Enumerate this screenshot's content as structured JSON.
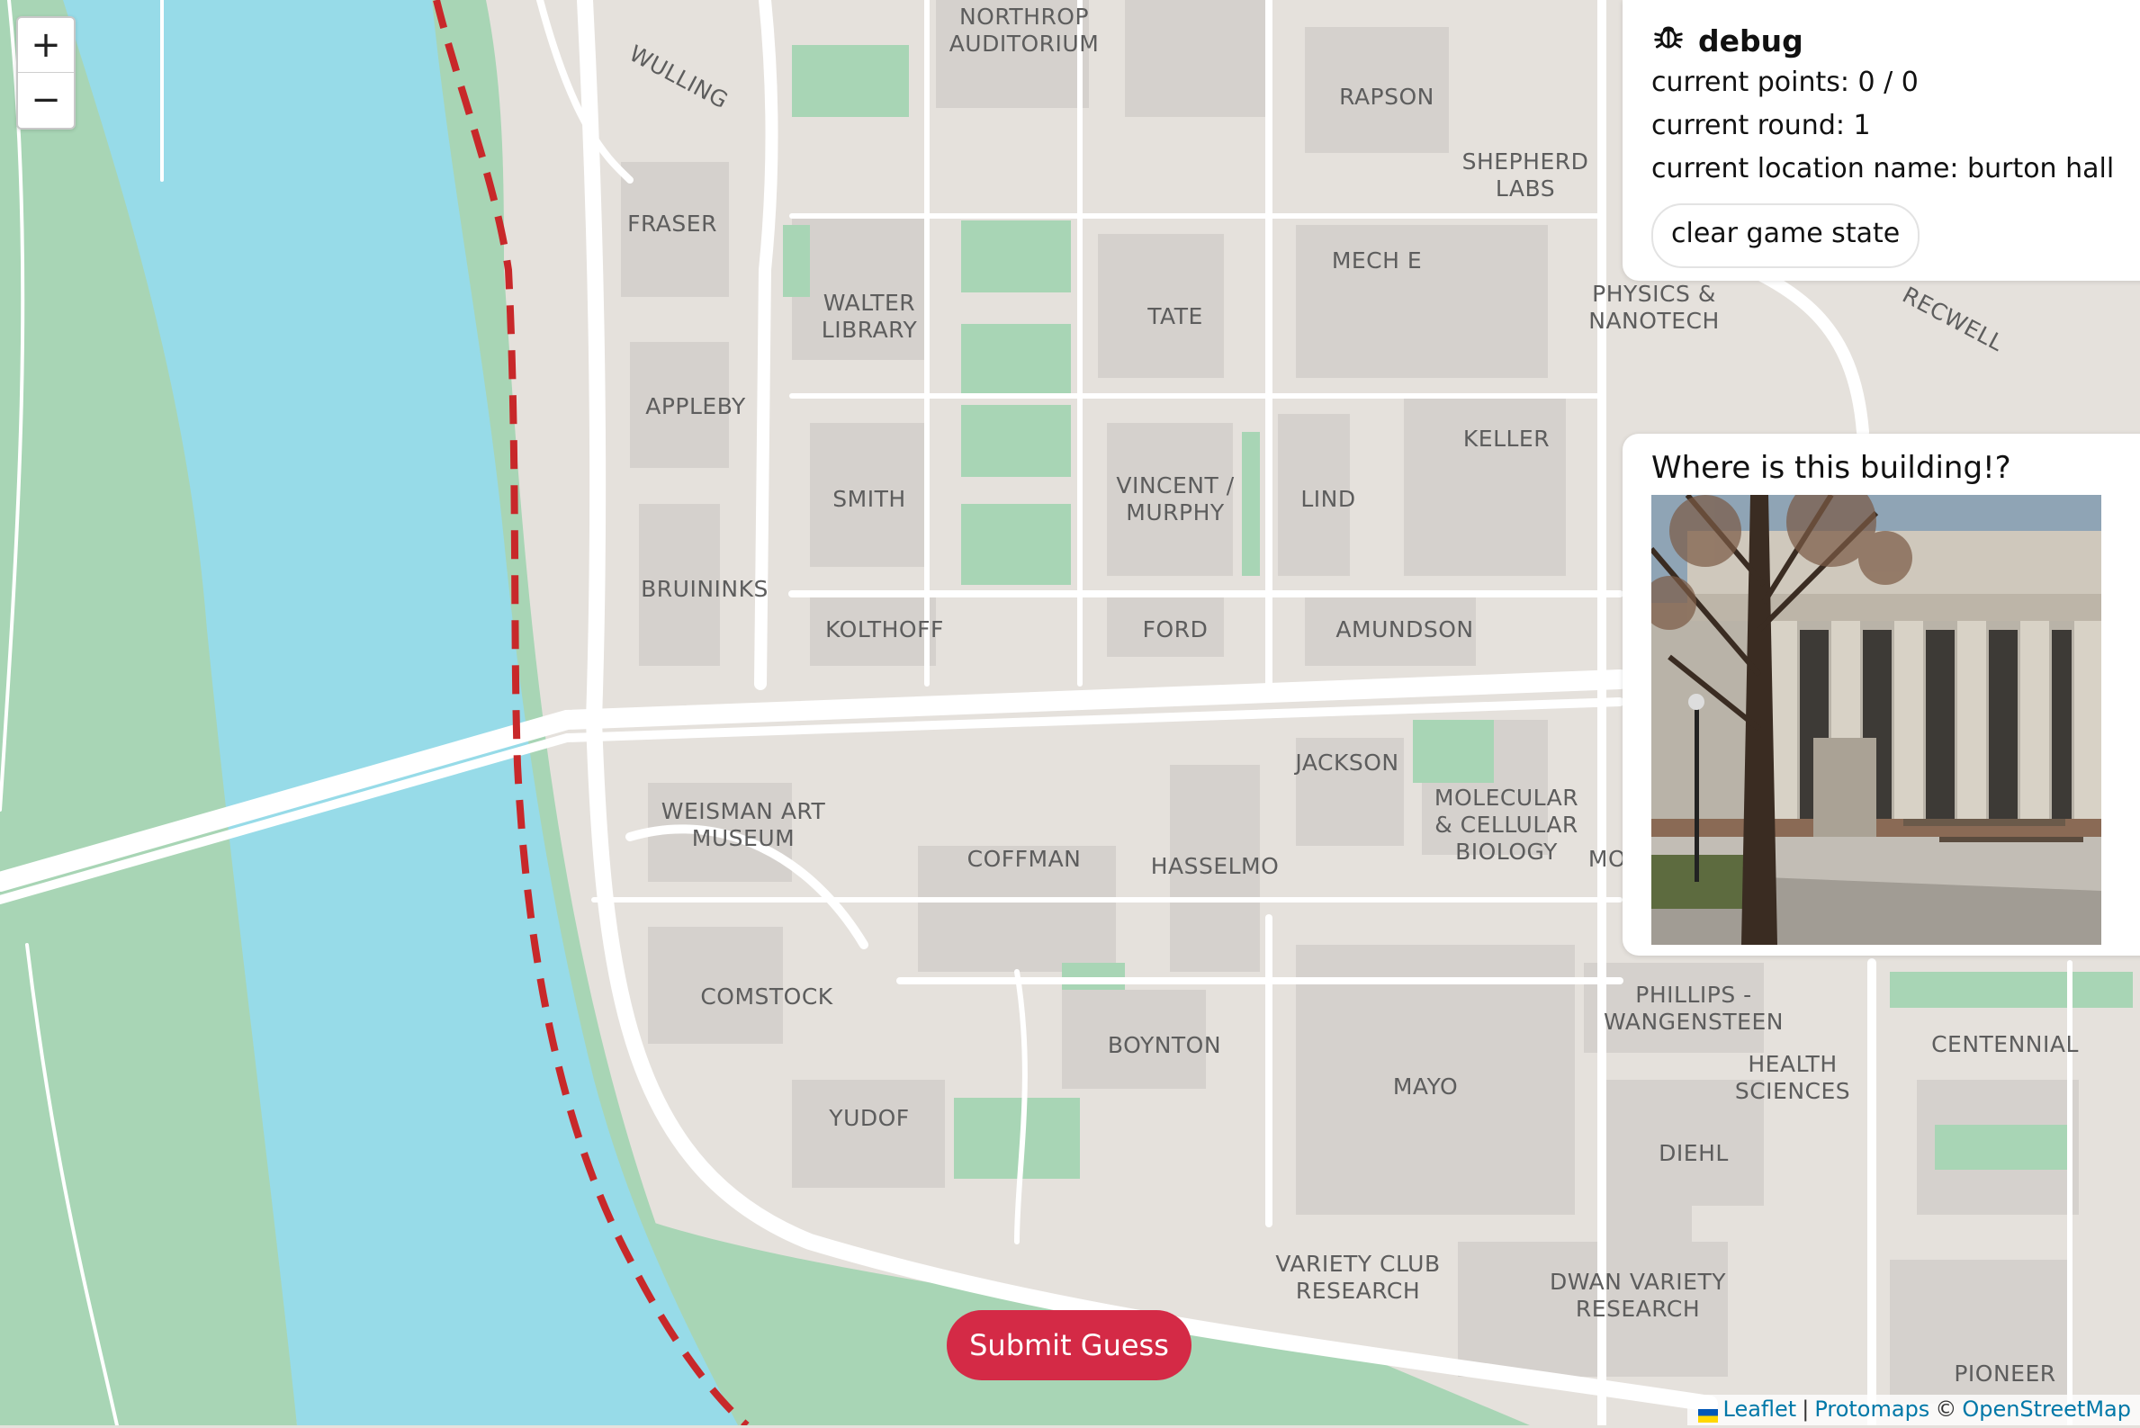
{
  "zoom": {
    "in_label": "+",
    "out_label": "−"
  },
  "map_labels": [
    "NORTHROP\nAUDITORIUM",
    "WULLING",
    "RAPSON",
    "SHEPHERD\nLABS",
    "FRASER",
    "WALTER\nLIBRARY",
    "TATE",
    "MECH E",
    "PHYSICS &\nNANOTECH",
    "RECWELL",
    "APPLEBY",
    "SMITH",
    "VINCENT /\nMURPHY",
    "LIND",
    "KELLER",
    "BRUININKS",
    "KOLTHOFF",
    "FORD",
    "AMUNDSON",
    "JACKSON",
    "MOLECULAR\n& CELLULAR\nBIOLOGY",
    "MO",
    "WEISMAN ART\nMUSEUM",
    "COFFMAN",
    "HASSELMO",
    "COMSTOCK",
    "BOYNTON",
    "PHILLIPS -\nWANGENSTEEN",
    "HEALTH\nSCIENCES",
    "CENTENNIAL",
    "MAYO",
    "YUDOF",
    "DIEHL",
    "VARIETY CLUB\nRESEARCH",
    "DWAN VARIETY\nRESEARCH",
    "PIONEER"
  ],
  "debug": {
    "title": "debug",
    "icon": "bug-icon",
    "points_line": "current points: 0 / 0",
    "round_line": "current round: 1",
    "location_line": "current location name: burton hall",
    "clear_button": "clear game state"
  },
  "guess_panel": {
    "question": "Where is this building!?"
  },
  "submit_button": "Submit Guess",
  "attribution": {
    "leaflet": "Leaflet",
    "sep": "|",
    "protomaps": "Protomaps",
    "copyright": "©",
    "osm": "OpenStreetMap"
  },
  "colors": {
    "water": "#97dbe8",
    "park": "#a8d5b5",
    "land": "#e5e1dc",
    "building": "#d5d1cd",
    "road": "#ffffff",
    "boundary": "#c8282a",
    "accent": "#d42a46"
  }
}
